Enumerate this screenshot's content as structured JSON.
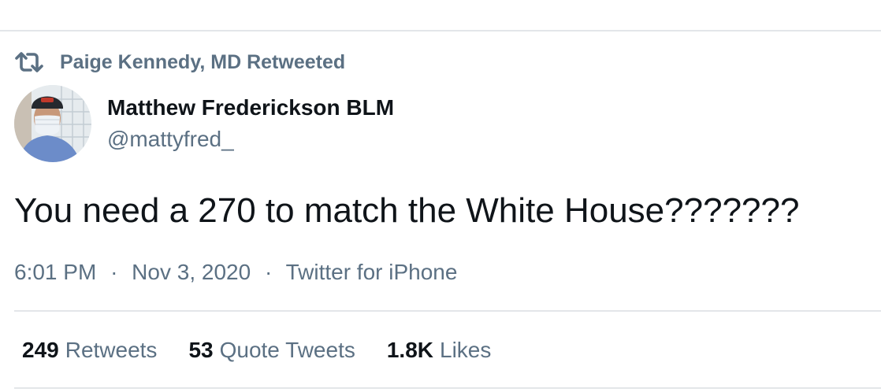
{
  "retweet": {
    "text": "Paige Kennedy, MD Retweeted",
    "icon": "retweet-icon"
  },
  "author": {
    "name": "Matthew Frederickson BLM",
    "handle": "@mattyfred_",
    "avatar_icon": "avatar"
  },
  "tweet": {
    "text": "You need a 270 to match the White House???????"
  },
  "meta": {
    "time": "6:01 PM",
    "separator": "·",
    "date": "Nov 3, 2020",
    "source": "Twitter for iPhone"
  },
  "stats": {
    "retweets": {
      "count": "249",
      "label": "Retweets"
    },
    "quote_tweets": {
      "count": "53",
      "label": "Quote Tweets"
    },
    "likes": {
      "count": "1.8K",
      "label": "Likes"
    }
  },
  "colors": {
    "text_primary": "#0f1419",
    "text_secondary": "#5b7083",
    "divider": "#e3e6e9"
  }
}
